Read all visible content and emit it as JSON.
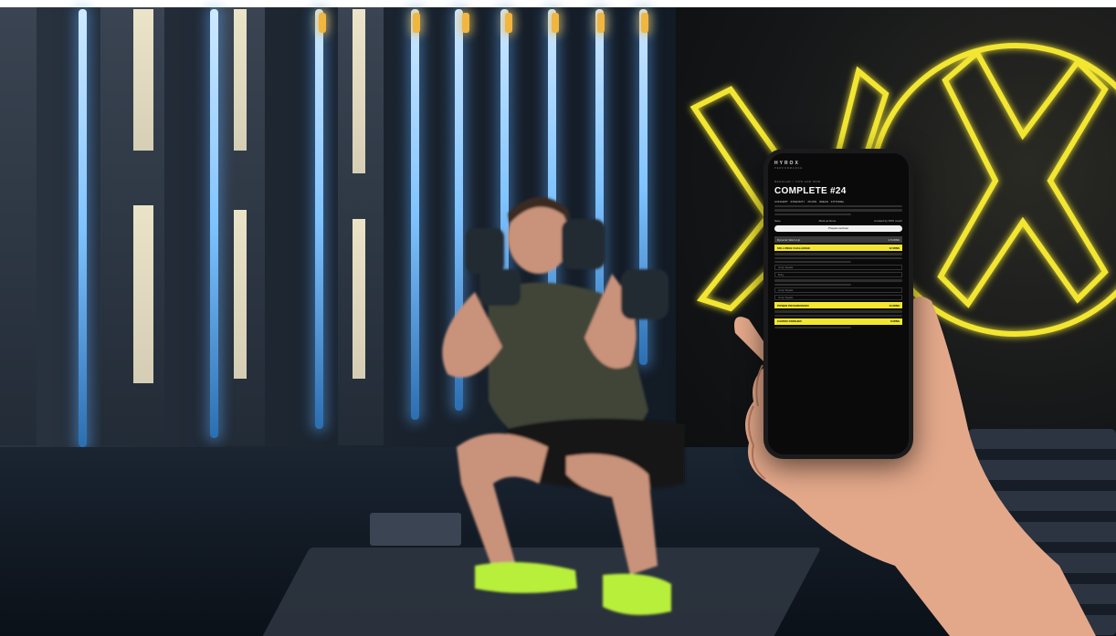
{
  "phone": {
    "brand": "HYROX",
    "brand_sub": "PERFORMANCE",
    "breadcrumb": "REGULAR > TIPS AND WOD",
    "title": "COMPLETE #24",
    "meta": [
      "CONCEPT",
      "INTENSITY",
      "25 MIN",
      "3REAS",
      "FITTOREL"
    ],
    "options": [
      "Save",
      "Mark as Done",
      "Curated by PRO coach"
    ],
    "button_label": "Prepare workout",
    "section_head": {
      "label": "Dynamic Warm-Up",
      "value": "4.5 MINS"
    },
    "blocks": [
      {
        "label": "SKI-LUNGE CHALLENGE",
        "value": "12 MINS"
      },
      {
        "label": "POWER PROGRESSION",
        "value": "10 MINS"
      },
      {
        "label": "CARDIO FINISHER",
        "value": "8 MINS"
      }
    ],
    "fields": [
      "Jump Squats",
      "Burg",
      "Jump Squats",
      "Jump Squats"
    ]
  },
  "colors": {
    "neon_yellow": "#f2e633",
    "neon_blue": "#7fc3ff",
    "shoe_green": "#b8ef3a"
  }
}
